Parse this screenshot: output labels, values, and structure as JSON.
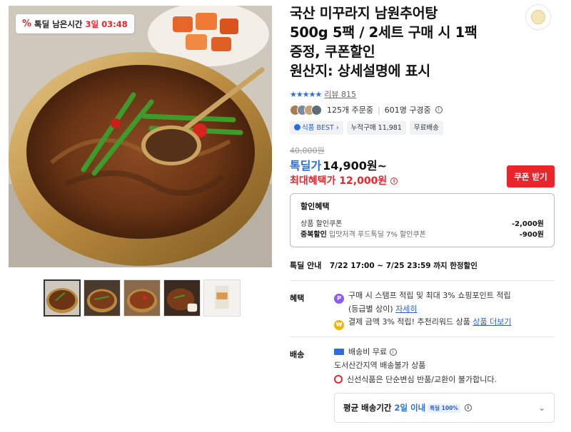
{
  "deal_timer": {
    "icon": "percent-icon",
    "label": "톡딜 남은시간",
    "time": "3일 03:48"
  },
  "title_lines": [
    "국산 미꾸라지 남원추어탕",
    "500g 5팩 / 2세트 구매 시 1팩",
    "증정, 쿠폰할인",
    "원산지: 상세설명에 표시"
  ],
  "rating": {
    "stars": "★★★★★",
    "review_label": "리뷰 815"
  },
  "social": {
    "orders": "125개 주문중",
    "subscribers": "601명 구경중"
  },
  "tags": [
    "식품 BEST ›",
    "누적구매 11,981",
    "무료배송"
  ],
  "price": {
    "original": "40,000원",
    "deal_label": "톡딜가",
    "deal_value": "14,900원~",
    "max_label": "최대혜택가",
    "max_value": "12,000원"
  },
  "coupon_button": "쿠폰 받기",
  "discount": {
    "heading": "할인혜택",
    "rows": [
      {
        "label": "상품 할인쿠폰",
        "desc": "",
        "amount": "-2,000원"
      },
      {
        "label": "중복할인",
        "desc": "입맛저격 푸드톡딜 7% 할인쿠폰",
        "amount": "-900원"
      }
    ]
  },
  "deal_guide": {
    "label": "톡딜 안내",
    "value": "7/22 17:00 ~ 7/25 23:59 까지 한정할인"
  },
  "benefits": {
    "label": "혜택",
    "items": [
      {
        "icon": "p-point-icon",
        "text": "구매 시 스탬프 적립 및 최대 3% 쇼핑포인트 적립",
        "sub": "(등급별 상이)",
        "link": "자세히"
      },
      {
        "icon": "coin-icon",
        "text": "결제 금액 3% 적립! 추천리워드 상품",
        "link": "상품 더보기"
      }
    ]
  },
  "shipping": {
    "label": "배송",
    "free": "배송비 무료",
    "note": "도서산간지역 배송불가 상품",
    "warning": "신선식품은 단순변심 반품/교환이 불가합니다.",
    "avg_label": "평균 배송기간",
    "avg_value": "2일 이내",
    "avg_badge": "톡딜 100%"
  },
  "colors": {
    "accent_red": "#e8262b",
    "accent_blue": "#2a6fe0"
  }
}
